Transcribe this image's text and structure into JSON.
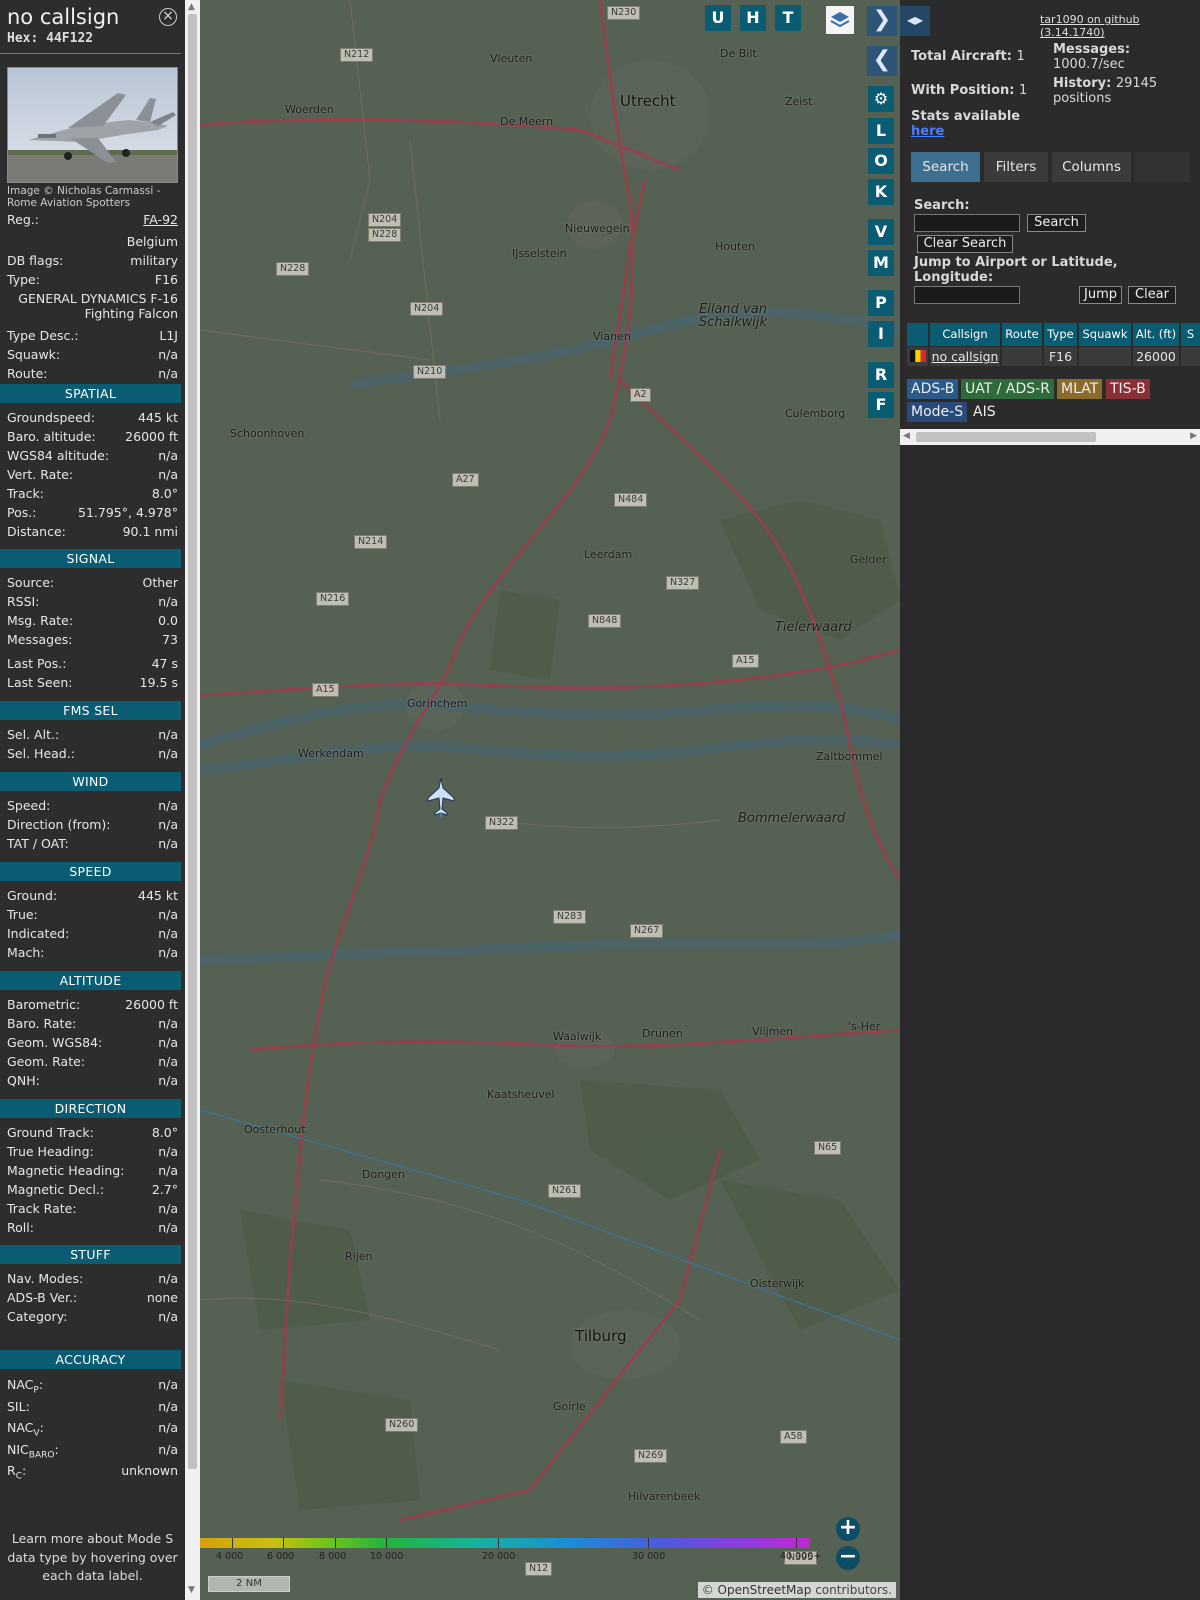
{
  "info": {
    "title": "no callsign",
    "hex": "Hex:  44F122",
    "photo_credit": "Image © Nicholas Carmassi - Rome Aviation Spotters",
    "reg_label": "Reg.:",
    "reg_value": "FA-92",
    "country": "Belgium",
    "dbflags_label": "DB flags:",
    "dbflags_value": "military",
    "type_label": "Type:",
    "type_value": "F16",
    "type_full": "GENERAL DYNAMICS F-16 Fighting Falcon",
    "typedesc_label": "Type Desc.:",
    "typedesc_value": "L1J",
    "squawk_label": "Squawk:",
    "squawk_value": "n/a",
    "route_label": "Route:",
    "route_value": "n/a",
    "sections": {
      "spatial": "SPATIAL",
      "signal": "SIGNAL",
      "fmssel": "FMS SEL",
      "wind": "WIND",
      "speed": "SPEED",
      "altitude": "ALTITUDE",
      "direction": "DIRECTION",
      "stuff": "STUFF",
      "accuracy": "ACCURACY"
    },
    "spatial": [
      {
        "k": "Groundspeed:",
        "v": "445 kt"
      },
      {
        "k": "Baro. altitude:",
        "v": "26000 ft"
      },
      {
        "k": "WGS84 altitude:",
        "v": "n/a"
      },
      {
        "k": "Vert. Rate:",
        "v": "n/a"
      },
      {
        "k": "Track:",
        "v": "8.0°"
      },
      {
        "k": "Pos.:",
        "v": "51.795°, 4.978°"
      },
      {
        "k": "Distance:",
        "v": "90.1 nmi"
      }
    ],
    "signal": [
      {
        "k": "Source:",
        "v": "Other"
      },
      {
        "k": "RSSI:",
        "v": "n/a"
      },
      {
        "k": "Msg. Rate:",
        "v": "0.0"
      },
      {
        "k": "Messages:",
        "v": "73"
      },
      {
        "k": "Last Pos.:",
        "v": "47 s"
      },
      {
        "k": "Last Seen:",
        "v": "19.5 s"
      }
    ],
    "fmssel": [
      {
        "k": "Sel. Alt.:",
        "v": "n/a"
      },
      {
        "k": "Sel. Head.:",
        "v": "n/a"
      }
    ],
    "wind": [
      {
        "k": "Speed:",
        "v": "n/a"
      },
      {
        "k": "Direction (from):",
        "v": "n/a"
      },
      {
        "k": "TAT / OAT:",
        "v": "n/a"
      }
    ],
    "speed": [
      {
        "k": "Ground:",
        "v": "445 kt"
      },
      {
        "k": "True:",
        "v": "n/a"
      },
      {
        "k": "Indicated:",
        "v": "n/a"
      },
      {
        "k": "Mach:",
        "v": "n/a"
      }
    ],
    "altitude": [
      {
        "k": "Barometric:",
        "v": "26000 ft"
      },
      {
        "k": "Baro. Rate:",
        "v": "n/a"
      },
      {
        "k": "Geom. WGS84:",
        "v": "n/a"
      },
      {
        "k": "Geom. Rate:",
        "v": "n/a"
      },
      {
        "k": "QNH:",
        "v": "n/a"
      }
    ],
    "direction": [
      {
        "k": "Ground Track:",
        "v": "8.0°"
      },
      {
        "k": "True Heading:",
        "v": "n/a"
      },
      {
        "k": "Magnetic Heading:",
        "v": "n/a"
      },
      {
        "k": "Magnetic Decl.:",
        "v": "2.7°"
      },
      {
        "k": "Track Rate:",
        "v": "n/a"
      },
      {
        "k": "Roll:",
        "v": "n/a"
      }
    ],
    "stuff": [
      {
        "k": "Nav. Modes:",
        "v": "n/a"
      },
      {
        "k": "ADS-B Ver.:",
        "v": "none"
      },
      {
        "k": "Category:",
        "v": "n/a"
      }
    ],
    "accuracy": [
      {
        "k": "NAC",
        "sub": "P",
        "v": "n/a"
      },
      {
        "k": "SIL:",
        "sub": "",
        "v": "n/a"
      },
      {
        "k": "NAC",
        "sub": "V",
        "v": "n/a"
      },
      {
        "k": "NIC",
        "sub": "BARO",
        "v": "n/a"
      },
      {
        "k": "R",
        "sub": "C",
        "v": "unknown"
      }
    ],
    "learn_more": "Learn more about Mode S data type by hovering over each data label."
  },
  "map": {
    "buttons_top": [
      "U",
      "H",
      "T"
    ],
    "buttons_side": [
      "L",
      "O",
      "K",
      "V",
      "M",
      "P",
      "I",
      "R",
      "F"
    ],
    "place_labels": [
      {
        "t": "Vleuten"
      },
      {
        "t": "De Bilt"
      },
      {
        "t": "Utrecht"
      },
      {
        "t": "Zeist"
      },
      {
        "t": "Woerden"
      },
      {
        "t": "De Meern"
      },
      {
        "t": "Nieuwegein"
      },
      {
        "t": "IJsselstein"
      },
      {
        "t": "Houten"
      },
      {
        "t": "Vianen"
      },
      {
        "t": "Eiland van Schalkwijk"
      },
      {
        "t": "Culemborg"
      },
      {
        "t": "Schoonhoven"
      },
      {
        "t": "Leerdam"
      },
      {
        "t": "Tielerwaard"
      },
      {
        "t": "Gorinchem"
      },
      {
        "t": "Werkendam"
      },
      {
        "t": "Zaltbommel"
      },
      {
        "t": "Bommelerwaard"
      },
      {
        "t": "Waalwijk"
      },
      {
        "t": "Drunen"
      },
      {
        "t": "Vlijmen"
      },
      {
        "t": "Kaatsheuvel"
      },
      {
        "t": "Oosterhout"
      },
      {
        "t": "Dongen"
      },
      {
        "t": "Rijen"
      },
      {
        "t": "Tilburg"
      },
      {
        "t": "Oisterwijk"
      },
      {
        "t": "Goirle"
      },
      {
        "t": "Hilvarenbeek"
      },
      {
        "t": "Gelder"
      },
      {
        "t": "'s-Her"
      }
    ],
    "road_labels": [
      "N230",
      "N212",
      "N204",
      "N228",
      "N228",
      "N204",
      "N210",
      "A2",
      "N484",
      "A27",
      "N214",
      "N216",
      "N327",
      "N848",
      "A15",
      "A15",
      "N322",
      "N283",
      "N267",
      "N261",
      "N65",
      "N260",
      "N269",
      "A58",
      "N12",
      "N395"
    ],
    "altitude_scale": [
      "4 000",
      "6 000",
      "8 000",
      "10 000",
      "20 000",
      "30 000",
      "40 000+"
    ],
    "scale_label": "2 NM",
    "attribution_prefix": "© ",
    "attribution_link": "OpenStreetMap",
    "attribution_suffix": " contributors.",
    "zoom_in": "+",
    "zoom_out": "−"
  },
  "right": {
    "github_link": "tar1090 on github (3.14.1740)",
    "total_aircraft_label": "Total Aircraft:",
    "total_aircraft_value": "1",
    "messages_label": "Messages:",
    "messages_value": "1000.7/sec",
    "with_position_label": "With Position:",
    "with_position_value": "1",
    "history_label": "History:",
    "history_value": "29145",
    "history_suffix": "positions",
    "stats_label": "Stats available",
    "stats_link": "here",
    "tabs": [
      "Search",
      "Filters",
      "Columns"
    ],
    "search_label": "Search:",
    "search_button": "Search",
    "clear_search_button": "Clear Search",
    "jump_label": "Jump to Airport or Latitude, Longitude:",
    "jump_button": "Jump",
    "clear_button": "Clear",
    "table_headers": [
      "",
      "Callsign",
      "Route",
      "Type",
      "Squawk",
      "Alt. (ft)",
      "S"
    ],
    "table_row": {
      "callsign": "no callsign",
      "route": "",
      "type": "F16",
      "squawk": "",
      "alt": "26000"
    },
    "sources": [
      "ADS-B",
      "UAT / ADS-R",
      "MLAT",
      "TIS-B",
      "Mode-S",
      "AIS"
    ],
    "colors": {
      "adsb": "#2a5a8a",
      "uat": "#2d6b3a",
      "mlat": "#8a6b2a",
      "tisb": "#8a2f35",
      "modes": "#2a4a7a"
    }
  }
}
